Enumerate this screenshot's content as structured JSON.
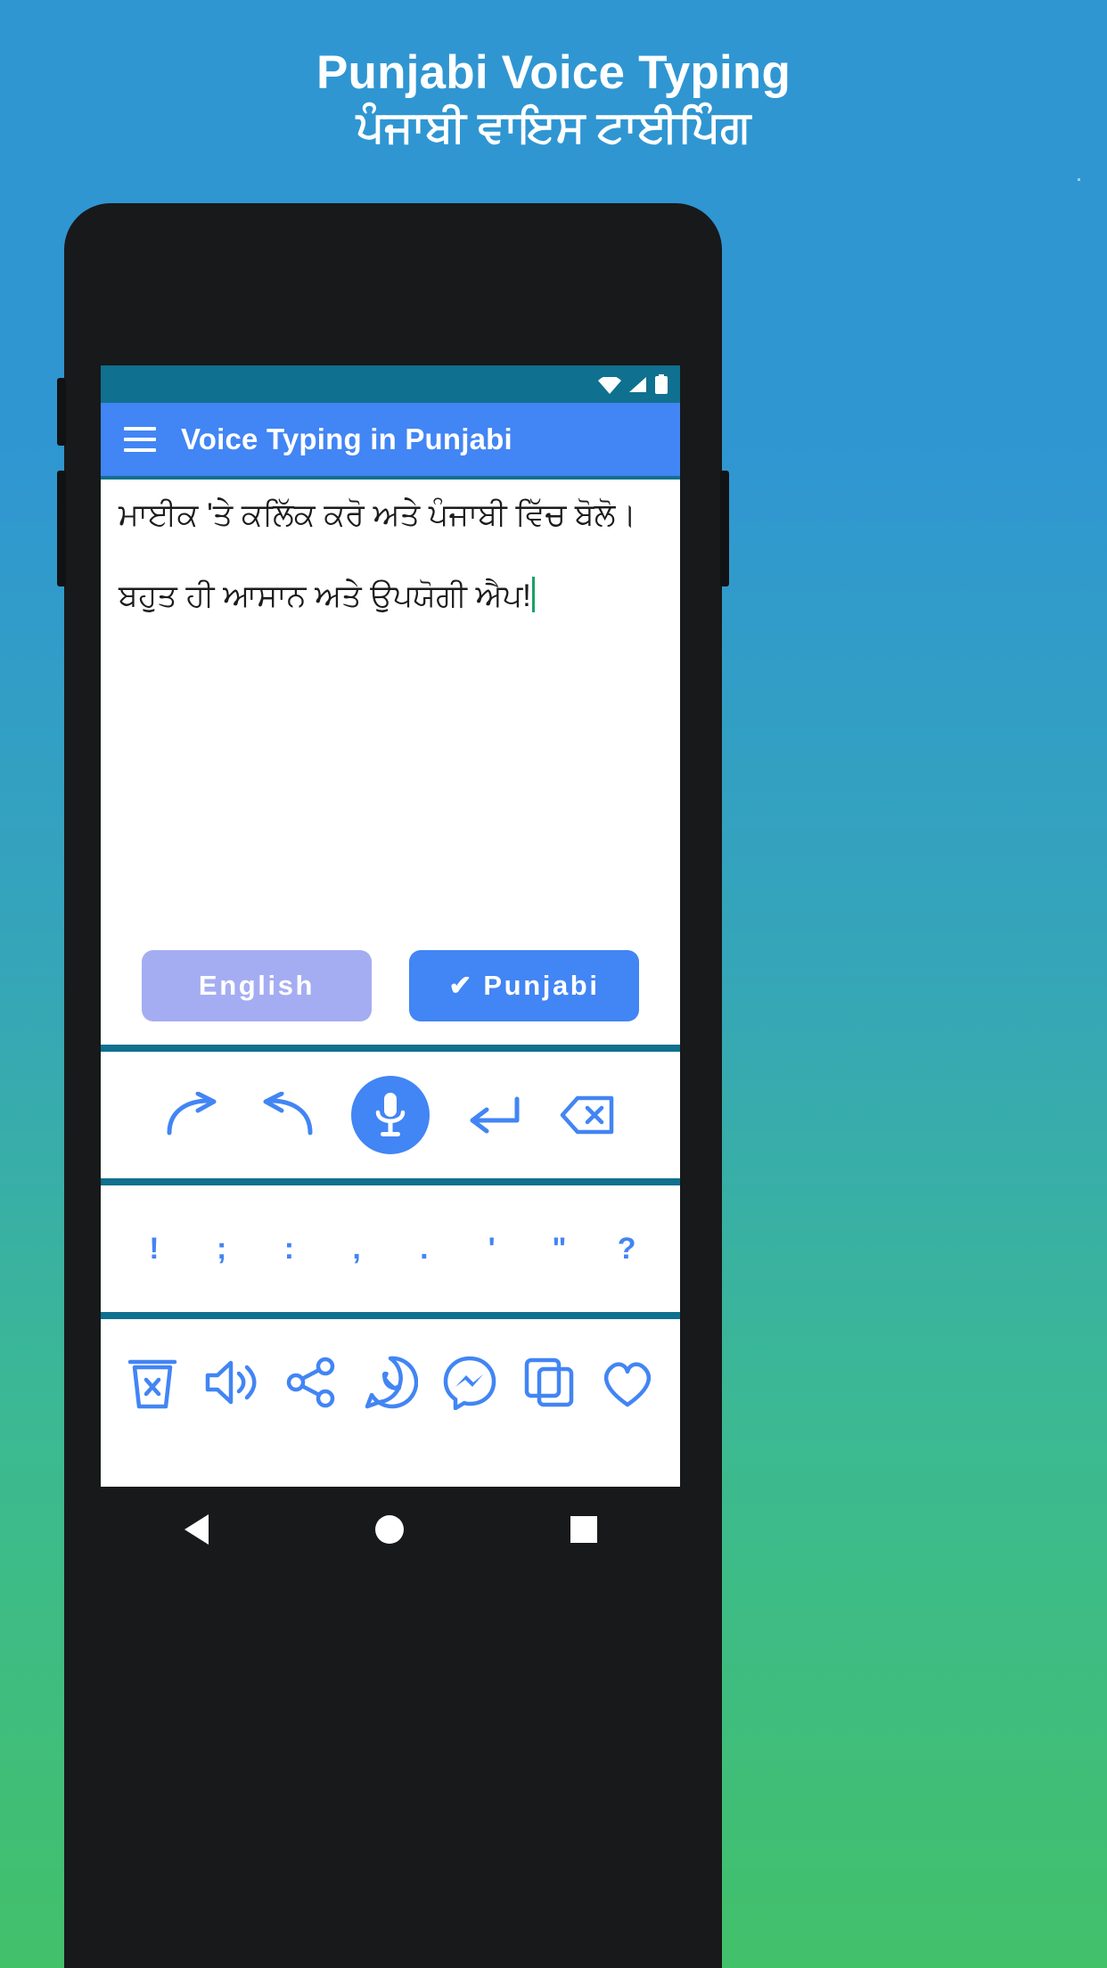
{
  "header": {
    "title_en": "Punjabi Voice Typing",
    "title_pa": "ਪੰਜਾਬੀ ਵਾਇਸ ਟਾਈਪਿੰਗ"
  },
  "colors": {
    "bg_top": "#2f96d2",
    "bg_bottom": "#42c06a",
    "appbar": "#4285f4",
    "statusbar": "#10708f",
    "accent": "#4285f4",
    "inactive_button": "#a5adf2",
    "caret": "#1aa06a",
    "phone_body": "#18191a"
  },
  "app": {
    "statusbar": {
      "icons": [
        "wifi-icon",
        "signal-icon",
        "battery-icon"
      ]
    },
    "appbar": {
      "menu_icon": "hamburger-menu-icon",
      "title": "Voice Typing in Punjabi"
    },
    "editor": {
      "lines": [
        "ਮਾਈਕ 'ਤੇ ਕਲਿੱਕ ਕਰੋ ਅਤੇ ਪੰਜਾਬੀ ਵਿੱਚ ਬੋਲੋ।",
        "ਬਹੁਤ ਹੀ ਆਸਾਨ ਅਤੇ ਉਪਯੋਗੀ ਐਪ!"
      ]
    },
    "language_buttons": [
      {
        "label": "English",
        "active": false
      },
      {
        "label": "Punjabi",
        "active": true,
        "check": "✔"
      }
    ],
    "toolbar": [
      {
        "name": "redo-icon",
        "label": "Redo"
      },
      {
        "name": "undo-icon",
        "label": "Undo"
      },
      {
        "name": "microphone-icon",
        "label": "Microphone"
      },
      {
        "name": "enter-icon",
        "label": "New line"
      },
      {
        "name": "backspace-icon",
        "label": "Backspace"
      }
    ],
    "punctuation": [
      "!",
      ";",
      ":",
      ",",
      ".",
      "'",
      "\"",
      "?"
    ],
    "actions": [
      {
        "name": "clear-trash-icon",
        "label": "Clear"
      },
      {
        "name": "speaker-icon",
        "label": "Speak"
      },
      {
        "name": "share-icon",
        "label": "Share"
      },
      {
        "name": "whatsapp-icon",
        "label": "WhatsApp"
      },
      {
        "name": "messenger-icon",
        "label": "Messenger"
      },
      {
        "name": "copy-icon",
        "label": "Copy"
      },
      {
        "name": "heart-icon",
        "label": "Favorite"
      }
    ],
    "navbar": [
      {
        "name": "nav-back-button",
        "label": "Back"
      },
      {
        "name": "nav-home-button",
        "label": "Home"
      },
      {
        "name": "nav-recents-button",
        "label": "Recents"
      }
    ]
  }
}
